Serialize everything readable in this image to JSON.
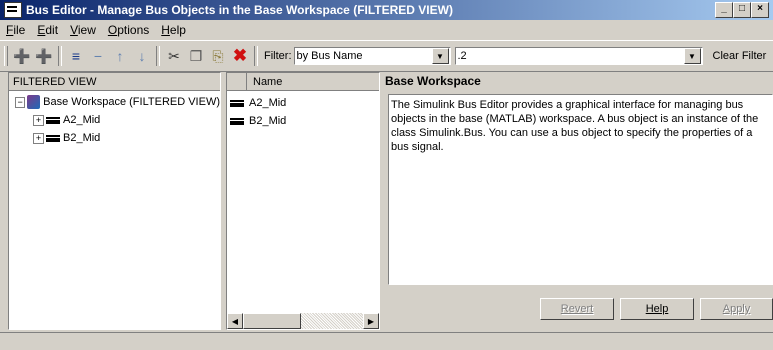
{
  "window": {
    "title": "Bus Editor - Manage Bus Objects in the Base Workspace (FILTERED VIEW)"
  },
  "menu": [
    {
      "u": "F",
      "rest": "ile"
    },
    {
      "u": "E",
      "rest": "dit"
    },
    {
      "u": "V",
      "rest": "iew"
    },
    {
      "u": "O",
      "rest": "ptions"
    },
    {
      "u": "H",
      "rest": "elp"
    }
  ],
  "toolbar": {
    "filter_label": "Filter:",
    "filter_by": "by Bus Name",
    "filter_text": ".2",
    "clear_filter": "Clear Filter"
  },
  "tree": {
    "header": "FILTERED VIEW",
    "root": "Base Workspace (FILTERED VIEW)",
    "children": [
      "A2_Mid",
      "B2_Mid"
    ]
  },
  "list": {
    "header": "Name",
    "items": [
      "A2_Mid",
      "B2_Mid"
    ]
  },
  "details": {
    "title": "Base Workspace",
    "description": "The Simulink Bus Editor provides a graphical interface for managing bus objects in the base (MATLAB) workspace. A bus object is an instance of the class Simulink.Bus. You can use a bus object to specify the properties of a bus signal."
  },
  "buttons": {
    "revert": "Revert",
    "help": "Help",
    "apply": "Apply"
  }
}
